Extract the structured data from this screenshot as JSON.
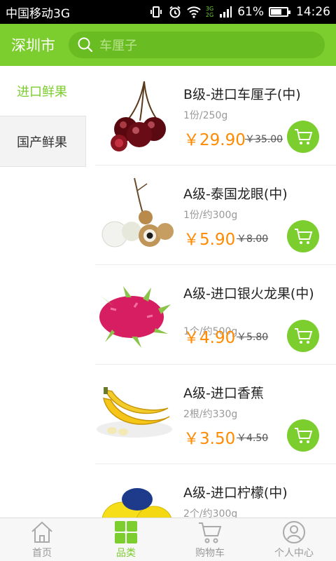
{
  "status_bar": {
    "carrier": "中国移动3G",
    "battery": "61%",
    "battery_level": 0.61,
    "time": "14:26",
    "net_top": "3G",
    "net_bottom": "2G"
  },
  "header": {
    "city": "深圳市",
    "search_placeholder": "车厘子"
  },
  "categories": [
    {
      "label": "进口鲜果",
      "active": true
    },
    {
      "label": "国产鲜果",
      "active": false
    }
  ],
  "products": [
    {
      "name": "B级-进口车厘子(中)",
      "spec": "1份/250g",
      "price": "￥29.90",
      "old_price": "￥35.00",
      "image": "cherry"
    },
    {
      "name": "A级-泰国龙眼(中)",
      "spec": "1份/约300g",
      "price": "￥5.90",
      "old_price": "￥8.00",
      "image": "longan"
    },
    {
      "name": "A级-进口银火龙果(中)",
      "spec": "1个/约500g",
      "price": "￥4.90",
      "old_price": "￥5.80",
      "image": "dragonfruit"
    },
    {
      "name": "A级-进口香蕉",
      "spec": "2根/约330g",
      "price": "￥3.50",
      "old_price": "￥4.50",
      "image": "banana"
    },
    {
      "name": "A级-进口柠檬(中)",
      "spec": "2个/约300g",
      "price": "",
      "old_price": "",
      "image": "lemon"
    }
  ],
  "tabs": [
    {
      "label": "首页",
      "icon": "home-icon",
      "active": false
    },
    {
      "label": "品类",
      "icon": "grid-icon",
      "active": true
    },
    {
      "label": "购物车",
      "icon": "cart-icon",
      "active": false
    },
    {
      "label": "个人中心",
      "icon": "user-icon",
      "active": false
    }
  ],
  "colors": {
    "accent": "#7ccd2e",
    "price": "#ff8a00"
  }
}
